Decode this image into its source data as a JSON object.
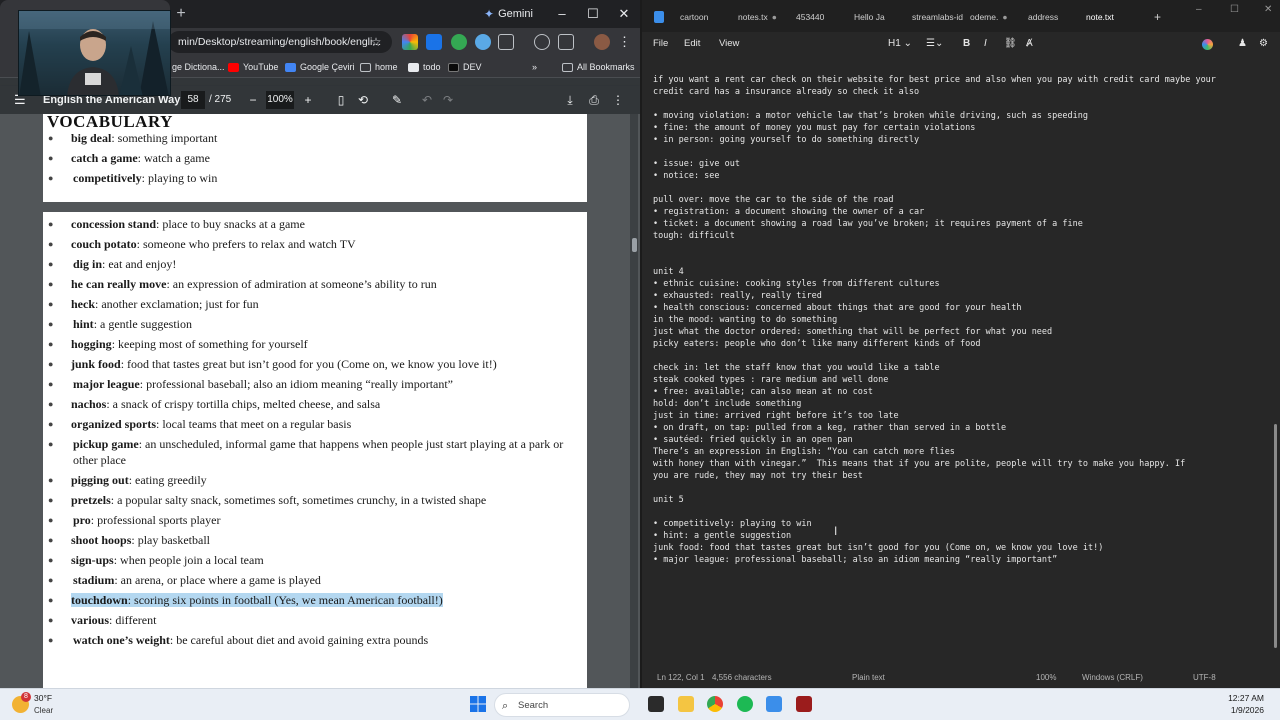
{
  "browser": {
    "gemini_label": "Gemini",
    "url": "min/Desktop/streaming/english/book/engli...",
    "bookmarks": [
      "ge Dictiona...",
      "YouTube",
      "Google Çeviri",
      "home",
      "todo",
      "DEV"
    ],
    "all_bookmarks_label": "All Bookmarks",
    "window_controls": {
      "minimize": "–",
      "maximize": "☐",
      "close": "✕"
    }
  },
  "pdf": {
    "title": "English the American Way",
    "page_current": "58",
    "page_total": "/ 275",
    "zoom": "100%",
    "section_title": "VOCABULARY",
    "page1_items": [
      {
        "term": "big deal",
        "def": ": something important"
      },
      {
        "term": "catch a game",
        "def": ": watch a game"
      },
      {
        "term": "competitively",
        "def": ": playing to win"
      }
    ],
    "page2_items": [
      {
        "term": "concession stand",
        "def": ": place to buy snacks at a game"
      },
      {
        "term": "couch potato",
        "def": ": someone who prefers to relax and watch TV"
      },
      {
        "term": "dig in",
        "def": ": eat and enjoy!"
      },
      {
        "term": "he can really move",
        "def": ": an expression of admiration at someone’s ability to run"
      },
      {
        "term": "heck",
        "def": ": another exclamation; just for fun"
      },
      {
        "term": "hint",
        "def": ": a gentle suggestion"
      },
      {
        "term": "hogging",
        "def": ": keeping most of something for yourself"
      },
      {
        "term": "junk food",
        "def": ": food that tastes great but isn’t good for you (Come on, we know you love it!)"
      },
      {
        "term": "major league",
        "def": ": professional baseball; also an idiom meaning “really important”"
      },
      {
        "term": "nachos",
        "def": ": a snack of crispy tortilla chips, melted cheese, and salsa"
      },
      {
        "term": "organized sports",
        "def": ": local teams that meet on a regular basis"
      },
      {
        "term": "pickup game",
        "def": ": an unscheduled, informal game that happens when people just start playing at a park or other place"
      },
      {
        "term": "pigging out",
        "def": ": eating greedily"
      },
      {
        "term": "pretzels",
        "def": ": a popular salty snack, sometimes soft, sometimes crunchy, in a twisted shape"
      },
      {
        "term": "pro",
        "def": ": professional sports player"
      },
      {
        "term": "shoot hoops",
        "def": ": play basketball"
      },
      {
        "term": "sign-ups",
        "def": ": when people join a local team"
      },
      {
        "term": "stadium",
        "def": ": an arena, or place where a game is played"
      },
      {
        "term": "touchdown",
        "def": ": scoring six points in football (Yes, we mean American football!)"
      },
      {
        "term": "various",
        "def": ": different"
      },
      {
        "term": "watch one’s weight",
        "def": ": be careful about diet and avoid gaining extra pounds"
      }
    ]
  },
  "notepad": {
    "tabs": [
      "cartoon",
      "notes.tx",
      "453440",
      "Hello Ja",
      "streamlabs-id",
      "odeme.",
      "address",
      "note.txt"
    ],
    "menu": {
      "file": "File",
      "edit": "Edit",
      "view": "View"
    },
    "heading_select": "H1",
    "format_buttons": {
      "bold": "B",
      "italic": "I"
    },
    "text_lines": [
      "if you want a rent car check on their website for best price and also when you pay with credit card maybe your",
      "credit card has a insurance already so check it also",
      "",
      "• moving violation: a motor vehicle law that’s broken while driving, such as speeding",
      "• fine: the amount of money you must pay for certain violations",
      "• in person: going yourself to do something directly",
      "",
      "• issue: give out",
      "• notice: see",
      "",
      "pull over: move the car to the side of the road",
      "• registration: a document showing the owner of a car",
      "• ticket: a document showing a road law you’ve broken; it requires payment of a fine",
      "tough: difficult",
      "",
      "",
      "unit 4",
      "• ethnic cuisine: cooking styles from different cultures",
      "• exhausted: really, really tired",
      "• health conscious: concerned about things that are good for your health",
      "in the mood: wanting to do something",
      "just what the doctor ordered: something that will be perfect for what you need",
      "picky eaters: people who don’t like many different kinds of food",
      "",
      "check in: let the staff know that you would like a table",
      "steak cooked types : rare medium and well done",
      "• free: available; can also mean at no cost",
      "hold: don’t include something",
      "just in time: arrived right before it’s too late",
      "• on draft, on tap: pulled from a keg, rather than served in a bottle",
      "• sautéed: fried quickly in an open pan",
      "There’s an expression in English: “You can catch more flies",
      "with honey than with vinegar.”  This means that if you are polite, people will try to make you happy. If",
      "you are rude, they may not try their best",
      "",
      "unit 5",
      "",
      "• competitively: playing to win",
      "• hint: a gentle suggestion",
      "junk food: food that tastes great but isn’t good for you (Come on, we know you love it!)",
      "• major league: professional baseball; also an idiom meaning “really important”"
    ],
    "status": {
      "position": "Ln 122, Col 1",
      "chars": "4,556 characters",
      "format": "Plain text",
      "zoom": "100%",
      "line_ending": "Windows (CRLF)",
      "encoding": "UTF-8"
    }
  },
  "taskbar": {
    "weather_badge": "8",
    "temperature": "30°F",
    "condition": "Clear",
    "search_placeholder": "Search",
    "time": "12:27 AM",
    "date": "1/9/2026"
  },
  "colors": {
    "highlight": "#b3d7f0",
    "pdf_bg": "#525659",
    "notepad_bg": "#272727",
    "taskbar_bg": "#e9eef5"
  }
}
